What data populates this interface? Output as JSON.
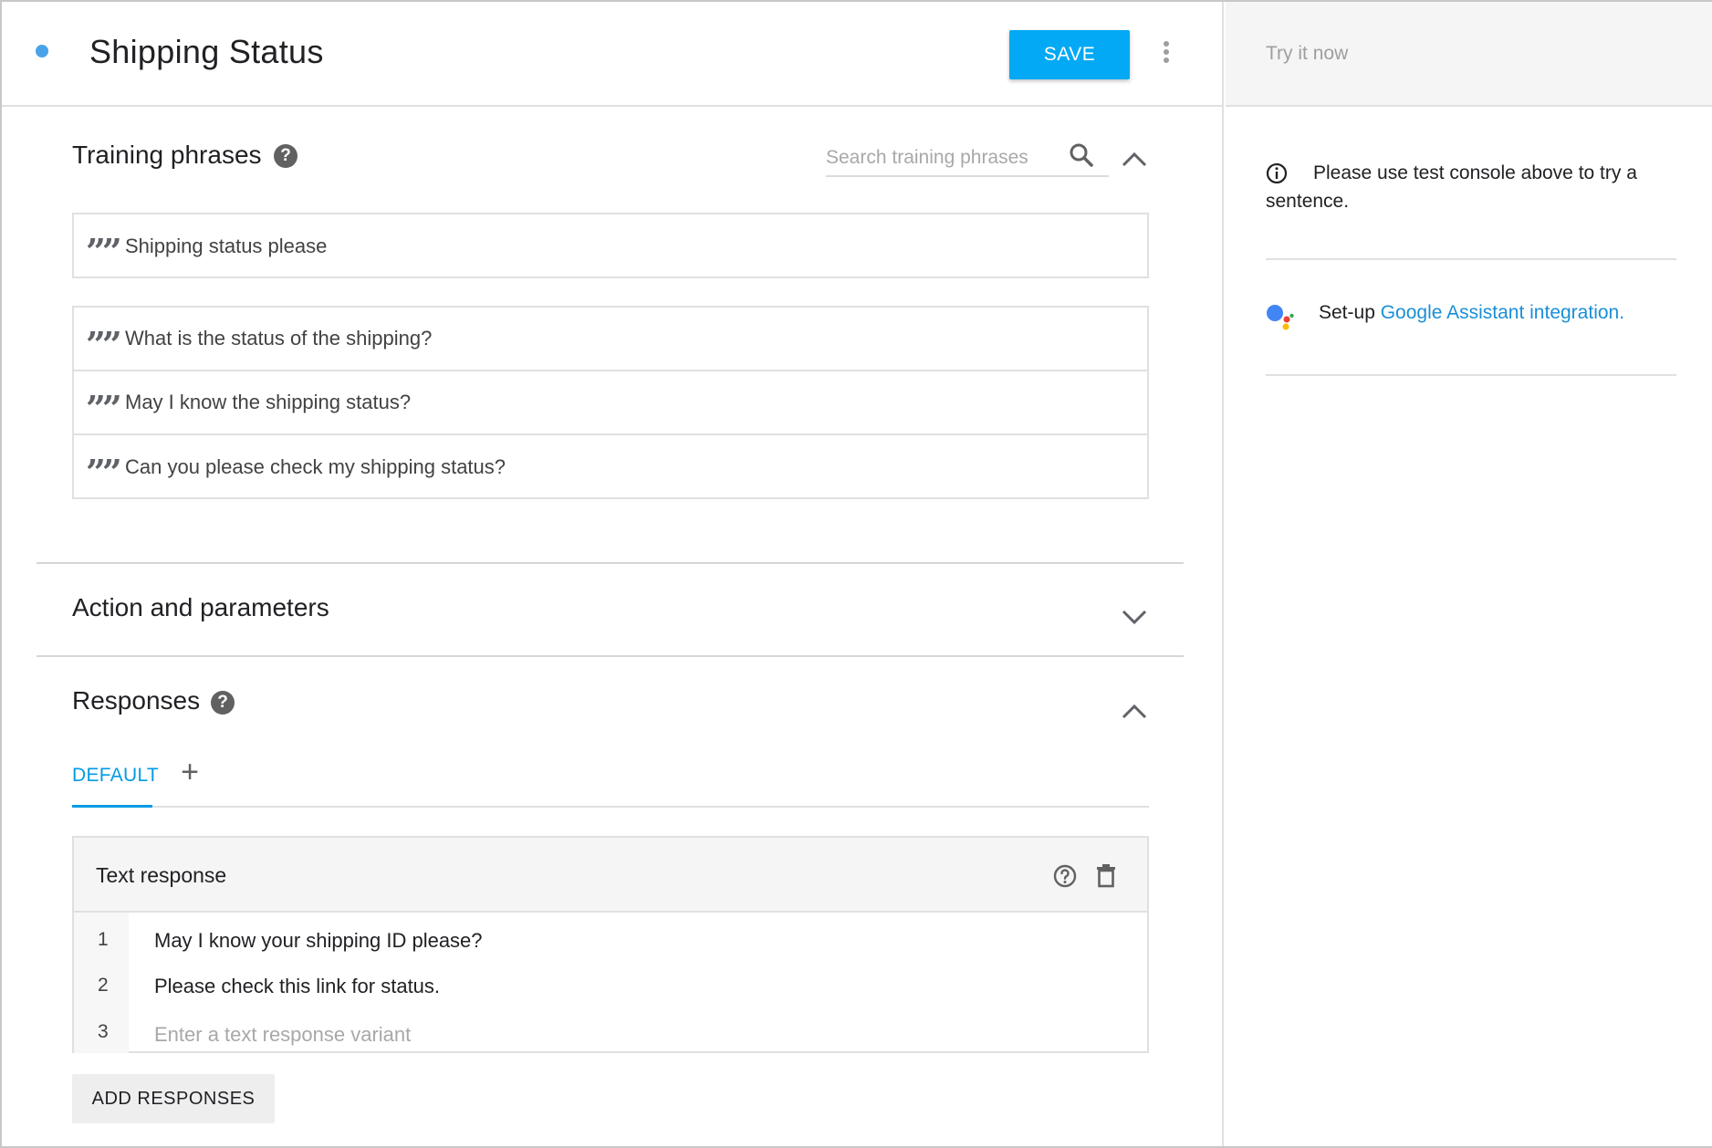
{
  "header": {
    "intent_title": "Shipping Status",
    "save_label": "SAVE"
  },
  "training": {
    "title": "Training phrases",
    "search_placeholder": "Search training phrases",
    "phrases": [
      "Shipping status please",
      "What is the status of the shipping?",
      "May I know the shipping status?",
      "Can you please check my shipping status?"
    ]
  },
  "action": {
    "title": "Action and parameters"
  },
  "responses": {
    "title": "Responses",
    "tab_default": "DEFAULT",
    "add_tab": "+",
    "card_title": "Text response",
    "lines": [
      {
        "num": "1",
        "text": "May I know your shipping ID please?"
      },
      {
        "num": "2",
        "text": "Please check this link for status."
      },
      {
        "num": "3",
        "placeholder": "Enter a text response variant"
      }
    ],
    "add_responses_label": "ADD RESPONSES"
  },
  "side": {
    "try_placeholder": "Try it now",
    "info_text": "Please use test console above to try a sentence.",
    "setup_prefix": "Set-up ",
    "setup_link": "Google Assistant integration."
  },
  "colors": {
    "accent": "#03a9f4",
    "link": "#1a8fd6",
    "status_dot": "#4aa3e8"
  },
  "icons": [
    "status-dot",
    "more-vert-icon",
    "help-icon",
    "search-icon",
    "chevron-up-icon",
    "chevron-down-icon",
    "quote-icon",
    "add-icon",
    "help-outline-icon",
    "trash-icon",
    "info-icon",
    "google-assistant-logo"
  ]
}
